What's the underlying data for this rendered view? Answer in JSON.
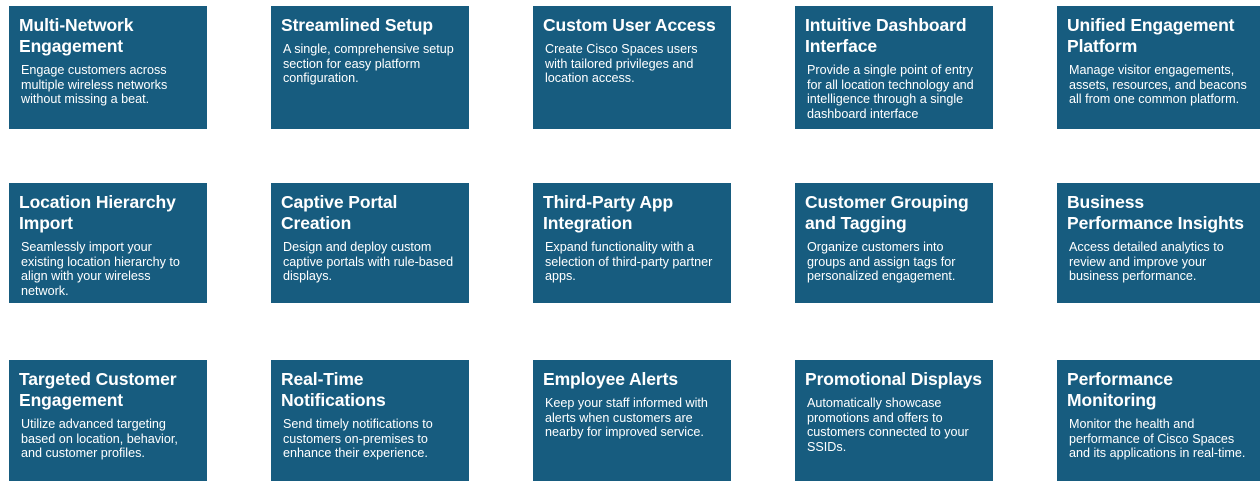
{
  "cards": [
    {
      "title": "Multi-Network Engagement",
      "desc": "Engage customers across multiple wireless networks without missing a beat."
    },
    {
      "title": "Streamlined Setup",
      "desc": "A single, comprehensive setup section for easy platform configuration."
    },
    {
      "title": "Custom User Access",
      "desc": "Create Cisco Spaces users with tailored privileges and location access."
    },
    {
      "title": "Intuitive Dashboard Interface",
      "desc": "Provide a single point of entry for all location technology and intelligence through a single dashboard interface"
    },
    {
      "title": "Unified Engagement Platform",
      "desc": "Manage visitor engagements, assets, resources, and beacons all from one common platform."
    },
    {
      "title": "Location Hierarchy Import",
      "desc": "Seamlessly import your existing location hierarchy to align with your wireless network."
    },
    {
      "title": "Captive Portal Creation",
      "desc": "Design and deploy custom captive portals with rule-based displays."
    },
    {
      "title": "Third-Party App Integration",
      "desc": "Expand functionality with a selection of third-party partner apps."
    },
    {
      "title": "Customer Grouping and Tagging",
      "desc": "Organize customers into groups and assign tags for personalized engagement."
    },
    {
      "title": "Business Performance Insights",
      "desc": "Access detailed analytics to review and improve your business performance."
    },
    {
      "title": "Targeted Customer Engagement",
      "desc": "Utilize advanced targeting based on location, behavior, and customer profiles."
    },
    {
      "title": "Real-Time Notifications",
      "desc": "Send timely notifications to customers on-premises to enhance their experience."
    },
    {
      "title": "Employee Alerts",
      "desc": "Keep your staff informed with alerts when customers are nearby for improved service."
    },
    {
      "title": "Promotional Displays",
      "desc": "Automatically showcase promotions and offers to customers connected to your SSIDs."
    },
    {
      "title": "Performance Monitoring",
      "desc": "Monitor the health and performance of Cisco Spaces and its applications in real-time."
    }
  ],
  "colors": {
    "card_background": "#175c7f",
    "card_text": "#ffffff",
    "page_background": "#ffffff"
  }
}
